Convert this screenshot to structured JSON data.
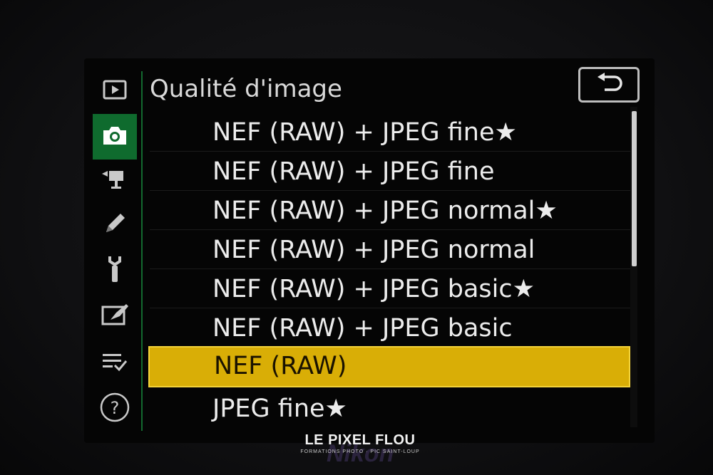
{
  "menu": {
    "title": "Qualité d'image",
    "items": [
      {
        "label": "NEF (RAW) + JPEG fine★",
        "selected": false
      },
      {
        "label": "NEF (RAW) + JPEG fine",
        "selected": false
      },
      {
        "label": "NEF (RAW) + JPEG normal★",
        "selected": false
      },
      {
        "label": "NEF (RAW) + JPEG normal",
        "selected": false
      },
      {
        "label": "NEF (RAW) + JPEG basic★",
        "selected": false
      },
      {
        "label": "NEF (RAW) + JPEG basic",
        "selected": false
      },
      {
        "label": "NEF (RAW)",
        "selected": true
      },
      {
        "label": "JPEG fine★",
        "selected": false
      }
    ],
    "scroll_fraction": 0.48
  },
  "tabs": [
    {
      "icon": "playback-icon",
      "active": false
    },
    {
      "icon": "camera-icon",
      "active": true
    },
    {
      "icon": "movie-icon",
      "active": false
    },
    {
      "icon": "pencil-icon",
      "active": false
    },
    {
      "icon": "wrench-icon",
      "active": false
    },
    {
      "icon": "retouch-icon",
      "active": false
    },
    {
      "icon": "my-menu-icon",
      "active": false
    },
    {
      "icon": "help-icon",
      "active": false
    }
  ],
  "back_button": {
    "icon": "return-arrow-icon"
  },
  "watermark": {
    "title": "LE PIXEL FLOU",
    "subtitle": "FORMATIONS PHOTO · PIC SAINT-LOUP",
    "brand": "Nikon"
  },
  "colors": {
    "selection": "#d9ae06",
    "active_tab": "#0f6b2e",
    "text": "#ececec"
  }
}
